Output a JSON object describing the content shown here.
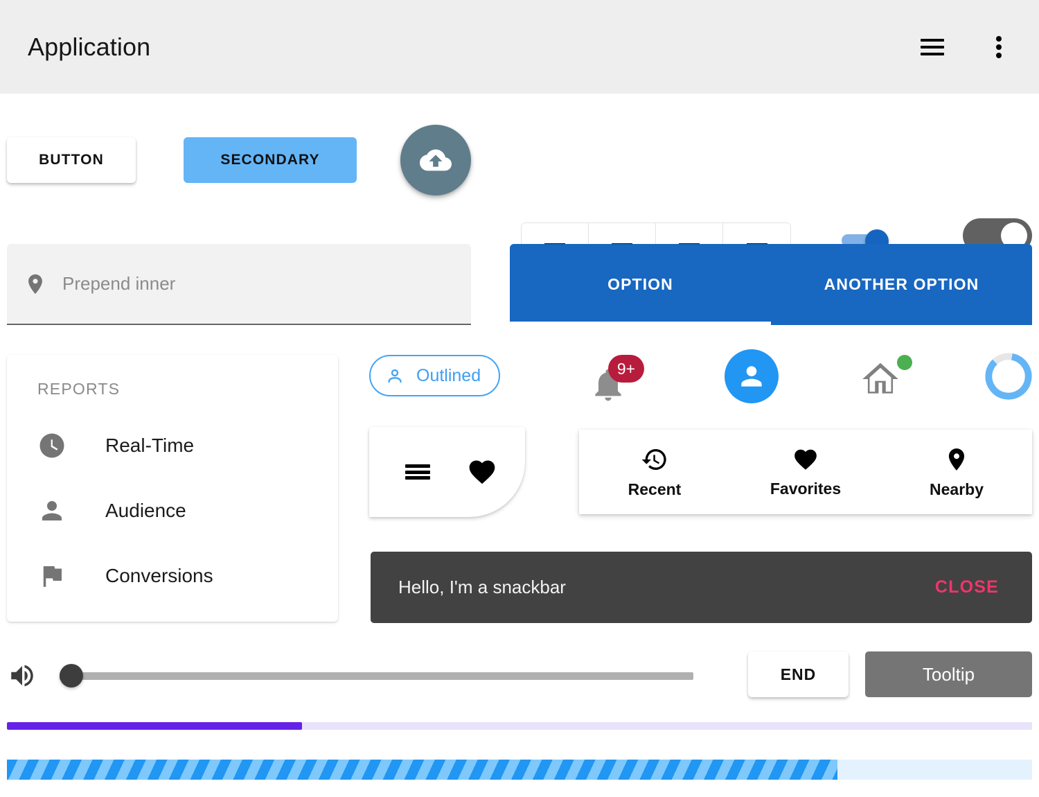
{
  "appbar": {
    "title": "Application",
    "menu_icon": "hamburger-menu-icon",
    "overflow_icon": "kebab-menu-icon"
  },
  "buttons": {
    "default_label": "BUTTON",
    "secondary_label": "SECONDARY",
    "secondary_color": "#64b5f6",
    "fab_icon": "cloud-upload-icon",
    "fab_color": "#607d8b"
  },
  "button_group": {
    "items": [
      {
        "icon": "format-align-left-icon",
        "name": "align-left"
      },
      {
        "icon": "format-align-center-icon",
        "name": "align-center"
      },
      {
        "icon": "format-align-right-icon",
        "name": "align-right"
      },
      {
        "icon": "format-align-justify-icon",
        "name": "align-justify"
      }
    ]
  },
  "switches": [
    {
      "name": "switch-primary-on",
      "state": "on",
      "color": "#1565c0"
    },
    {
      "name": "switch-dark-off",
      "state": "off",
      "color": "#4a4a4a"
    },
    {
      "name": "switch-inset-on",
      "state": "on",
      "color": "#616161"
    },
    {
      "name": "switch-inset-off",
      "state": "off",
      "color": "#bdbdbd"
    }
  ],
  "textfield": {
    "placeholder": "Prepend inner",
    "value": "",
    "prepend_icon": "location-pin-icon"
  },
  "tabs": {
    "color": "#1867c0",
    "items": [
      {
        "label": "OPTION",
        "active": true
      },
      {
        "label": "ANOTHER OPTION",
        "active": false
      }
    ]
  },
  "reports_list": {
    "subheader": "REPORTS",
    "items": [
      {
        "label": "Real-Time",
        "icon": "clock-icon"
      },
      {
        "label": "Audience",
        "icon": "person-icon"
      },
      {
        "label": "Conversions",
        "icon": "flag-icon"
      }
    ]
  },
  "chip": {
    "label": "Outlined",
    "icon": "account-circle-icon",
    "color": "#42a5f5"
  },
  "badges": {
    "notification_icon": "bell-icon",
    "notification_count": "9+",
    "notification_color": "#b71c3c",
    "avatar_icon": "person-icon",
    "avatar_color": "#2196f3",
    "home_icon": "home-icon",
    "home_dot_color": "#4caf50"
  },
  "circular_progress": {
    "name": "circular-progress",
    "value": 85,
    "color": "#64b5f6",
    "track_color": "#e6e6e6"
  },
  "icon_card": {
    "menu_icon": "menu-icon",
    "favorite_icon": "heart-icon"
  },
  "bottom_nav": {
    "items": [
      {
        "label": "Recent",
        "icon": "history-icon"
      },
      {
        "label": "Favorites",
        "icon": "heart-icon"
      },
      {
        "label": "Nearby",
        "icon": "location-pin-icon"
      }
    ]
  },
  "snackbar": {
    "message": "Hello, I'm a snackbar",
    "action_label": "CLOSE",
    "action_color": "#f0356b",
    "background": "#424242"
  },
  "slider": {
    "icon": "volume-up-icon",
    "value": 0,
    "track_color": "#b0b0b0",
    "thumb_color": "#3d3d3d"
  },
  "end_button": {
    "label": "END"
  },
  "tooltip": {
    "label": "Tooltip",
    "background": "#757575"
  },
  "progress_linear": {
    "name": "determinate-progress",
    "value": 29,
    "color": "#6621e8",
    "track_color": "#e8e3fb"
  },
  "progress_buffer": {
    "name": "buffer-progress",
    "value": 81,
    "color": "#2196f3",
    "stripe_color": "#7ec8fb",
    "track_color": "#e3f2fd"
  }
}
